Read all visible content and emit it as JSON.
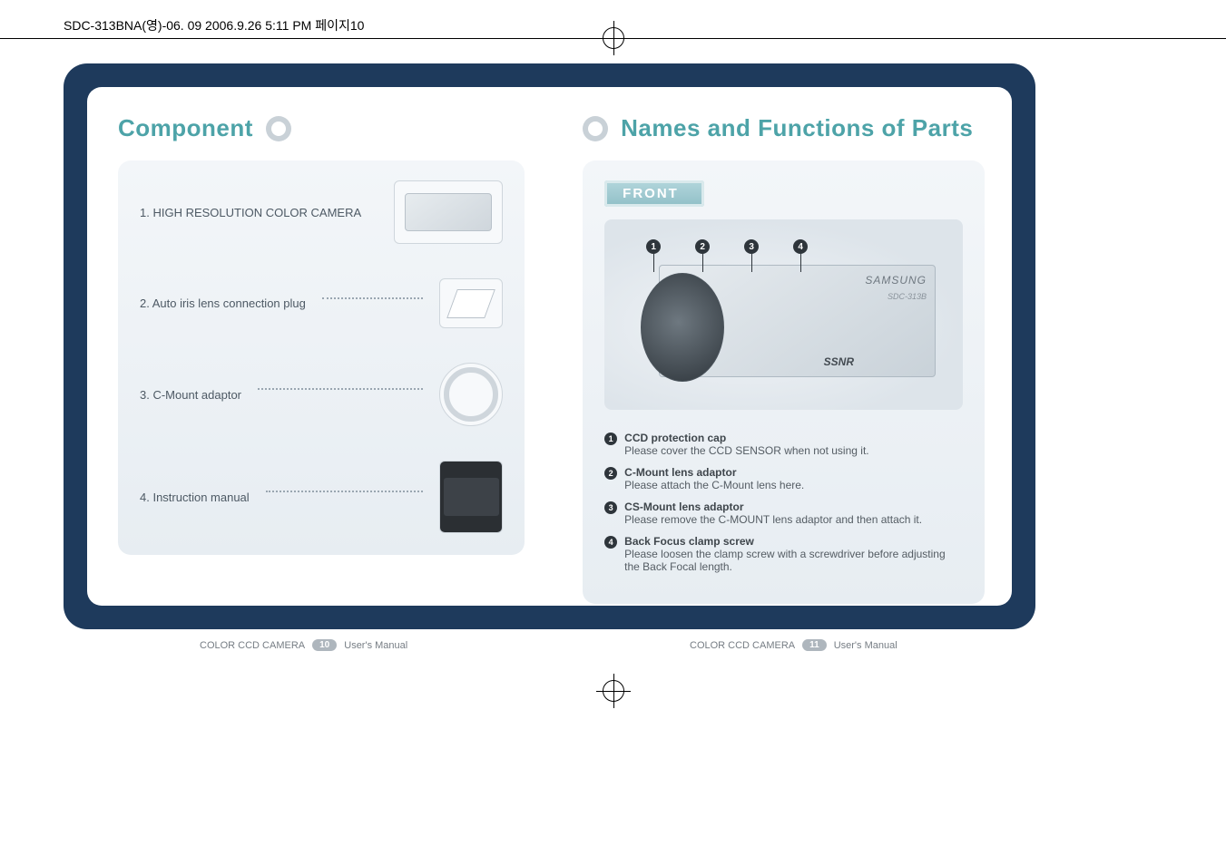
{
  "header_label": "SDC-313BNA(영)-06. 09  2006.9.26 5:11 PM  페이지10",
  "left": {
    "title": "Component",
    "items": [
      {
        "label": "1. HIGH RESOLUTION COLOR CAMERA",
        "thumb": "camera"
      },
      {
        "label": "2. Auto iris lens connection plug",
        "thumb": "plug"
      },
      {
        "label": "3. C-Mount adaptor",
        "thumb": "ring"
      },
      {
        "label": "4. Instruction manual",
        "thumb": "manual"
      }
    ]
  },
  "right": {
    "title": "Names and Functions of Parts",
    "subtab": "FRONT",
    "figure": {
      "callouts": [
        "1",
        "2",
        "3",
        "4"
      ],
      "brand": "SAMSUNG",
      "model": "SDC-313B",
      "badge": "SSNR"
    },
    "defs": [
      {
        "num": "1",
        "title": "CCD protection cap",
        "desc": "Please cover the CCD SENSOR when not using it."
      },
      {
        "num": "2",
        "title": "C-Mount lens adaptor",
        "desc": "Please attach the C-Mount lens here."
      },
      {
        "num": "3",
        "title": "CS-Mount lens adaptor",
        "desc": "Please remove the C-MOUNT lens adaptor and then attach it."
      },
      {
        "num": "4",
        "title": "Back Focus clamp screw",
        "desc": "Please loosen the clamp screw with a screwdriver before adjusting the Back Focal length."
      }
    ]
  },
  "footer": {
    "series": "COLOR CCD CAMERA",
    "label": "User's Manual",
    "left_page": "10",
    "right_page": "11"
  }
}
